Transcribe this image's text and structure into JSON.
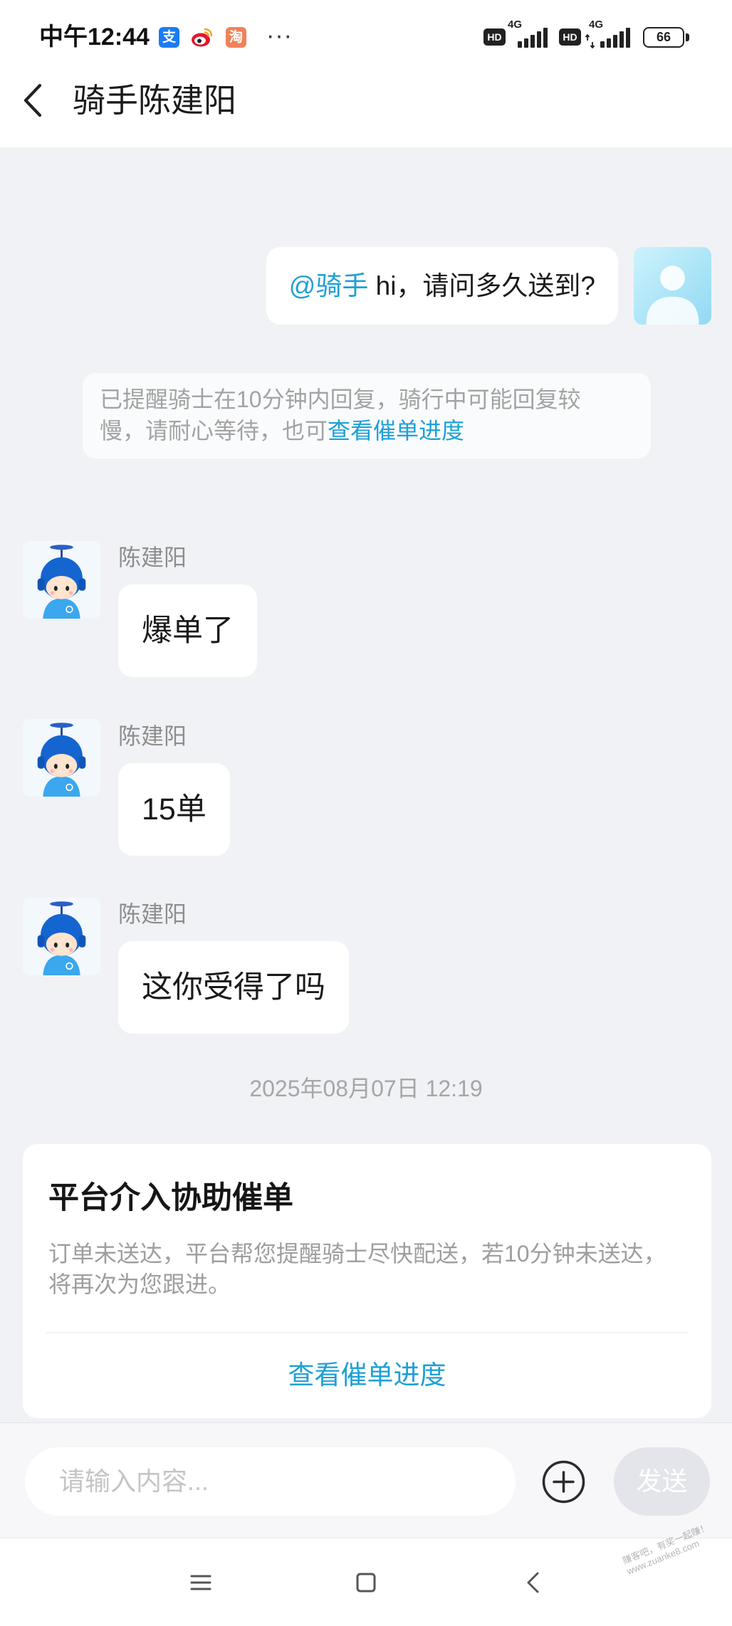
{
  "status_bar": {
    "time": "中午12:44",
    "app_icons": [
      {
        "name": "alipay-icon",
        "glyph": "支",
        "color": "#1a7cf5"
      },
      {
        "name": "weibo-icon",
        "color": "#e6162d"
      },
      {
        "name": "taobao-icon",
        "glyph": "淘",
        "color": "#f0825a"
      }
    ],
    "more": "···",
    "sims": [
      {
        "hd": "HD",
        "network": "4G"
      },
      {
        "hd": "HD",
        "network": "4G"
      }
    ],
    "battery": "66"
  },
  "header": {
    "back_icon": "chevron-left-icon",
    "title": "骑手陈建阳"
  },
  "chat": {
    "outgoing": {
      "mention": "@骑手",
      "text": " hi，请问多久送到?"
    },
    "system_notice": {
      "text": "已提醒骑士在10分钟内回复，骑行中可能回复较慢，请耐心等待，也可",
      "link": "查看催单进度"
    },
    "incoming": [
      {
        "sender": "陈建阳",
        "text": "爆单了"
      },
      {
        "sender": "陈建阳",
        "text": "15单"
      },
      {
        "sender": "陈建阳",
        "text": "这你受得了吗"
      }
    ],
    "timestamp": "2025年08月07日 12:19"
  },
  "card": {
    "title": "平台介入协助催单",
    "description": "订单未送达，平台帮您提醒骑士尽快配送，若10分钟未送达，将再次为您跟进。",
    "action": "查看催单进度"
  },
  "composer": {
    "placeholder": "请输入内容...",
    "add_icon": "plus-circle-icon",
    "send_label": "发送"
  },
  "nav_bar": {
    "icons": [
      "menu-icon",
      "home-square-icon",
      "back-icon"
    ]
  },
  "watermark": {
    "line1": "赚客吧，有奖一起赚！",
    "line2": "www.zuanke8.com"
  },
  "colors": {
    "accent": "#1ea0d6",
    "chat_background": "#f1f2f6",
    "bubble": "#ffffff",
    "muted_text": "#9e9e9e",
    "send_button_disabled": "#e3e5ea"
  }
}
